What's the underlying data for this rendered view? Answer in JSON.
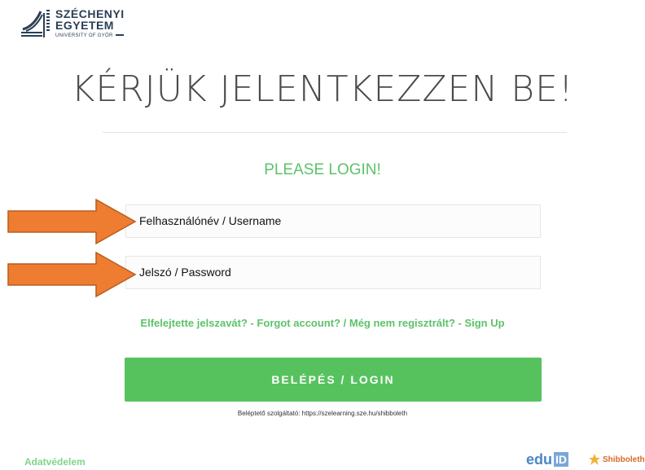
{
  "logo": {
    "line1": "SZÉCHENYI",
    "line2": "EGYETEM",
    "line3": "UNIVERSITY OF GYŐR"
  },
  "page_title": "KÉRJÜK JELENTKEZZEN BE!",
  "subtitle": "PLEASE LOGIN!",
  "form": {
    "username_label": "Felhasználónév / Username",
    "password_label": "Jelszó / Password"
  },
  "links": {
    "forgot": "Elfelejtette jelszavát? - Forgot account?",
    "separator": " / ",
    "signup": "Még nem regisztrált? - Sign Up"
  },
  "login_button": "BELÉPÉS / LOGIN",
  "provider_text": "Beléptető szolgáltató: https://szelearning.sze.hu/shibboleth",
  "footer": {
    "privacy": "Adatvédelem",
    "eduid_text": "edu",
    "eduid_box": "ID",
    "shibboleth": "Shibboleth"
  },
  "colors": {
    "accent_green": "#56c25e",
    "link_green": "#5cc26a",
    "arrow_orange": "#ee7d31",
    "logo_navy": "#2a3f55"
  },
  "annotations": {
    "arrows": [
      "arrow-to-username",
      "arrow-to-password"
    ]
  }
}
